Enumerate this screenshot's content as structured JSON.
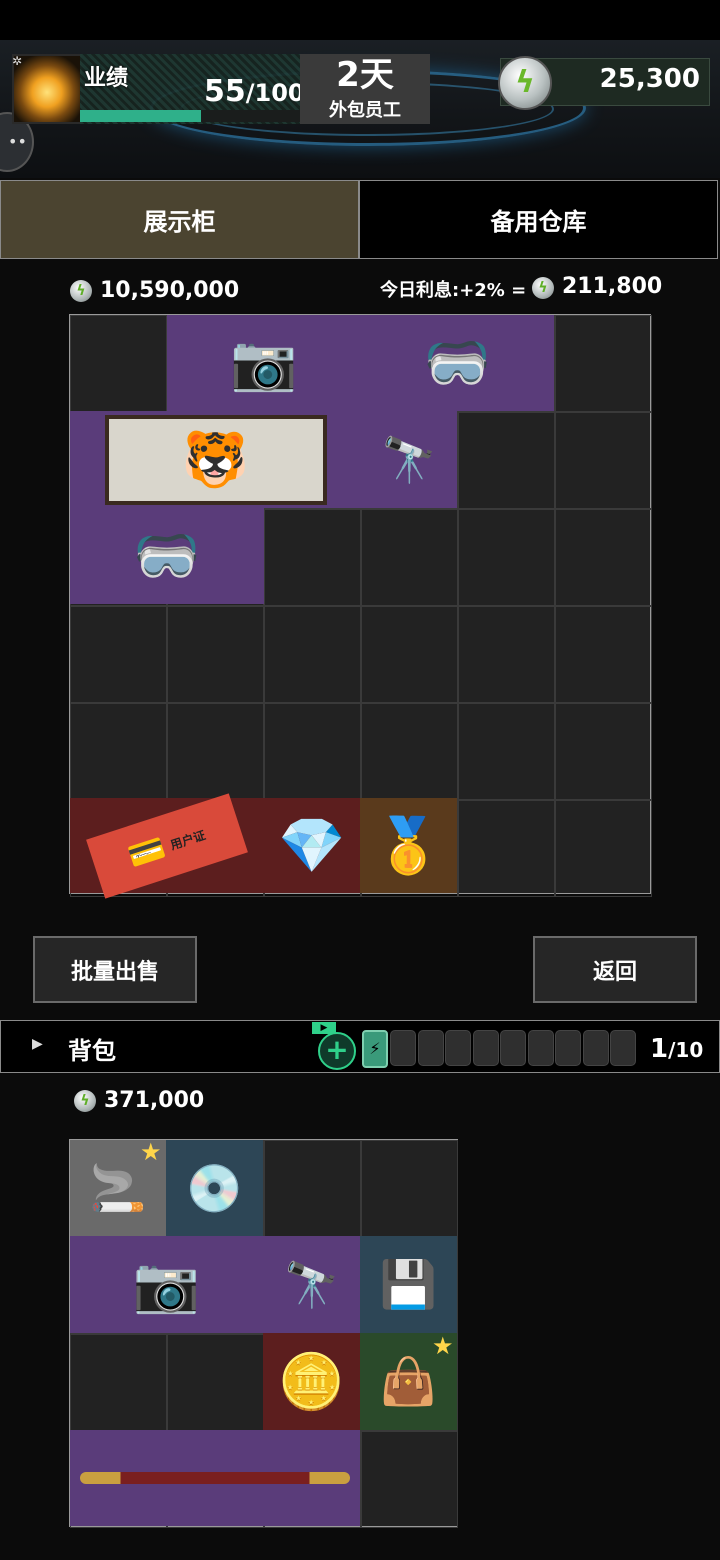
{
  "hud": {
    "performance_label": "业绩",
    "performance_value": "55",
    "performance_max": "/100",
    "performance_fraction": 0.55,
    "days": "2天",
    "employee_type": "外包员工",
    "coins": "25,300",
    "coin_icon": "lightning-coin-icon",
    "avatar_icon": "flame-icon"
  },
  "tabs": [
    {
      "label": "展示柜",
      "active": true
    },
    {
      "label": "备用仓库",
      "active": false
    }
  ],
  "display": {
    "total_value": "10,590,000",
    "interest_label": "今日利息:+2% =",
    "interest_value": "211,800",
    "items": [
      {
        "name": "camera",
        "icon": "📷"
      },
      {
        "name": "vr-headset",
        "icon": "🥽"
      },
      {
        "name": "tiger-painting",
        "icon": "🐯"
      },
      {
        "name": "scope",
        "icon": "🔭"
      },
      {
        "name": "vr-headset",
        "icon": "🥽"
      },
      {
        "name": "meta-account-card",
        "icon": "💳",
        "label": "用户证"
      },
      {
        "name": "crystal",
        "icon": "💎"
      },
      {
        "name": "gold-nugget",
        "icon": "🥇"
      }
    ]
  },
  "buttons": {
    "bulk_sell": "批量出售",
    "back": "返回"
  },
  "bag": {
    "title": "背包",
    "count": "1",
    "max": "/10",
    "tv_label": "▶",
    "plus_label": "+",
    "battery_label": "⚡",
    "total_value": "371,000",
    "items": [
      {
        "name": "cigarette-pack",
        "icon": "🚬",
        "starred": true
      },
      {
        "name": "disc",
        "icon": "💿"
      },
      {
        "name": "camera",
        "icon": "📷"
      },
      {
        "name": "scope",
        "icon": "🔭"
      },
      {
        "name": "hard-drive",
        "icon": "💾"
      },
      {
        "name": "silver-coin",
        "icon": "🪙"
      },
      {
        "name": "bag-charm",
        "icon": "👜",
        "starred": true
      },
      {
        "name": "golden-staff",
        "icon": "🥢"
      }
    ]
  }
}
